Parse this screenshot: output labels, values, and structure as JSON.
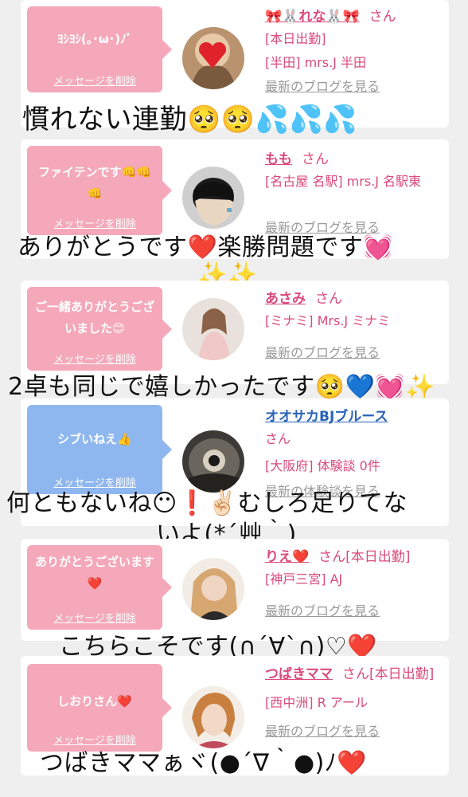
{
  "messages": [
    {
      "bubble_text": "ﾖｼﾖｼ(｡･ω･)ﾉﾞ",
      "delete_label": "メッセージを削除",
      "name": "🎀🐰れな🐰🎀",
      "san": "さん",
      "line1": "[本日出勤]",
      "line2": "[半田] mrs.J 半田",
      "line3": "最新のブログを見る",
      "caption": "慣れない連勤🥺🥺💦💦💦"
    },
    {
      "bubble_text": "ファイテンです👊👊👊",
      "delete_label": "メッセージを削除",
      "name": "もも",
      "san": "さん",
      "line1": "[名古屋 名駅] mrs.J 名駅東",
      "line3": "最新のブログを見る",
      "caption": "ありがとうです❤️楽勝問題です💓",
      "caption2": "✨✨"
    },
    {
      "bubble_text": "ご一緒ありがとうございました😊",
      "delete_label": "メッセージを削除",
      "name": "あさみ",
      "san": "さん",
      "line1": "[ミナミ] Mrs.J ミナミ",
      "line3": "最新のブログを見る",
      "caption": "2卓も同じで嬉しかったです🥺💙💓✨"
    },
    {
      "bubble_text": "シブいねえ👍",
      "delete_label": "メッセージを削除",
      "name": "オオサカBJブルース",
      "san": "さん",
      "line1": "[大阪府] 体験談 0件",
      "line3": "最新の体験談を見る",
      "caption": "何ともないね😶❗️✌🏻むしろ足りてな",
      "caption2": "いよ(*´艸｀)"
    },
    {
      "bubble_text": "ありがとうございます❤️",
      "delete_label": "メッセージを削除",
      "name": "りえ❤️",
      "san": "さん[本日出勤]",
      "line1": "[神戸三宮] AJ",
      "line3": "最新のブログを見る",
      "caption": "こちらこそです(∩´∀`∩)♡❤️"
    },
    {
      "bubble_text": "しおりさん❤️",
      "delete_label": "メッセージを削除",
      "name": "つばきママ",
      "san": "さん[本日出勤]",
      "line1": "[西中洲] R アール",
      "line3": "最新のブログを見る",
      "caption": "つばきママぁヾ(●´∇｀●)ﾉ❤️"
    }
  ]
}
